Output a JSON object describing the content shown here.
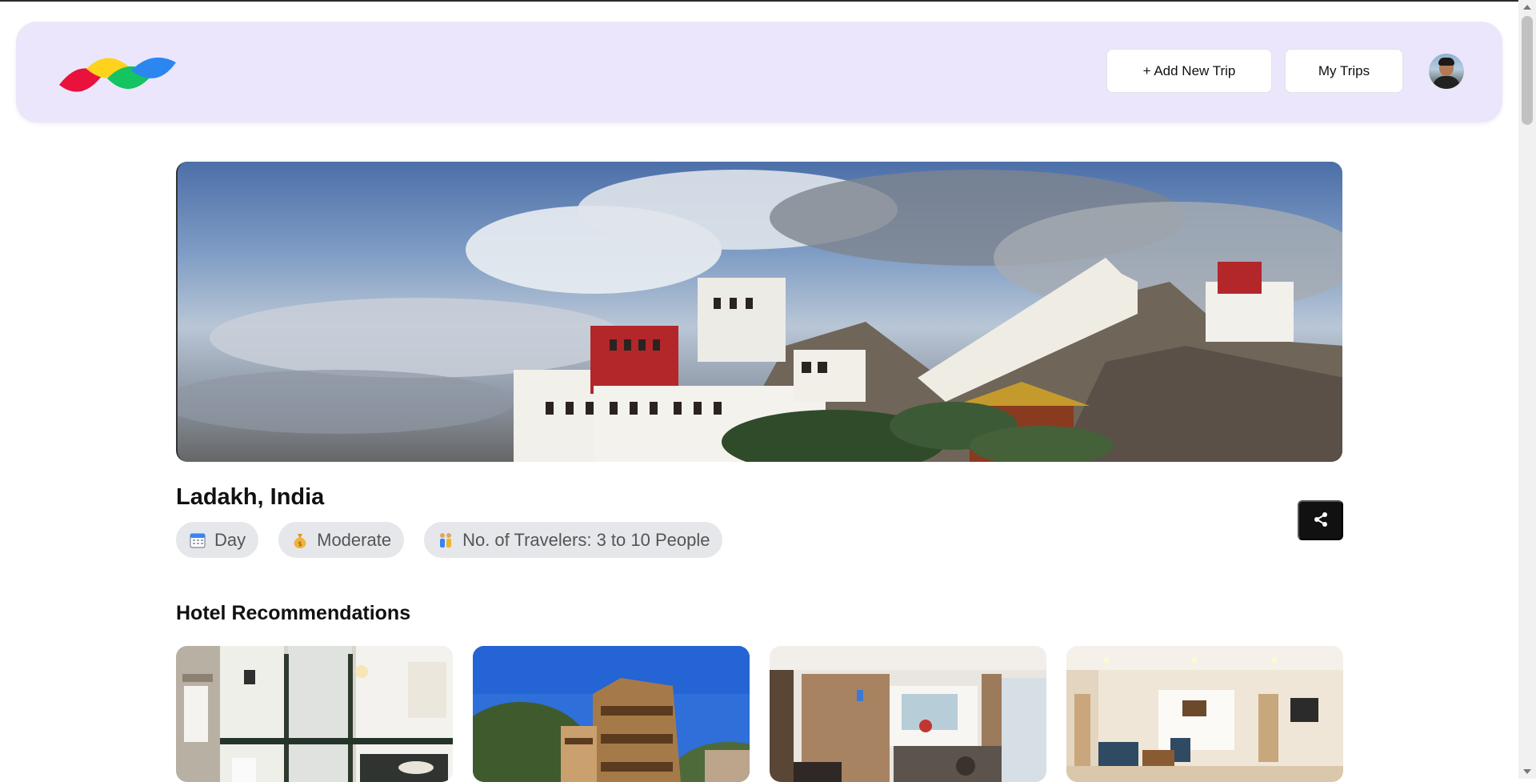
{
  "header": {
    "logo_alt": "",
    "add_trip_label": "+ Add New Trip",
    "my_trips_label": "My Trips"
  },
  "trip": {
    "title": "Ladakh, India",
    "chips": [
      {
        "icon": "calendar-icon",
        "label": "Day"
      },
      {
        "icon": "money-bag-icon",
        "label": "Moderate"
      },
      {
        "icon": "people-icon",
        "label": "No. of Travelers: 3 to 10 People"
      }
    ]
  },
  "hotels": {
    "section_title": "Hotel Recommendations"
  },
  "colors": {
    "header_bg": "#ebe6fb",
    "chip_bg": "#e5e7eb",
    "share_bg": "#111111"
  }
}
